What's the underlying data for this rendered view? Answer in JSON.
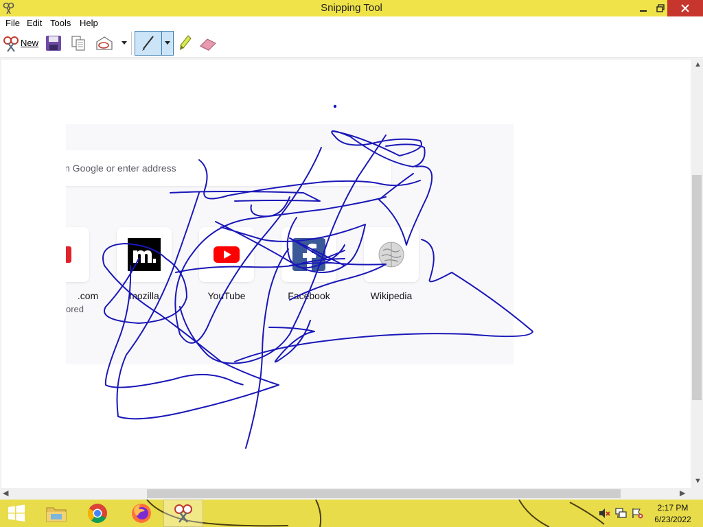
{
  "window": {
    "title": "Snipping Tool"
  },
  "menu": {
    "items": [
      "File",
      "Edit",
      "Tools",
      "Help"
    ]
  },
  "toolbar": {
    "new_label": "New",
    "icons": [
      "snip-scissors-icon",
      "save-icon",
      "copy-icon",
      "send-snip-icon",
      "pen-icon",
      "highlighter-icon",
      "eraser-icon"
    ]
  },
  "captured": {
    "search_placeholder": "n Google or enter address",
    "tiles": [
      {
        "label": ".com",
        "sublabel": "ored",
        "icon": "partial-red-logo-icon"
      },
      {
        "label": "mozilla",
        "icon": "mozilla-logo-icon"
      },
      {
        "label": "YouTube",
        "icon": "youtube-logo-icon"
      },
      {
        "label": "Facebook",
        "icon": "facebook-logo-icon"
      },
      {
        "label": "Wikipedia",
        "icon": "wikipedia-logo-icon"
      }
    ]
  },
  "annotation": {
    "pen_color": "#1a17b8"
  },
  "taskbar": {
    "time": "2:17 PM",
    "date": "6/23/2022",
    "apps": [
      "windows-start-icon",
      "file-explorer-icon",
      "chrome-icon",
      "firefox-icon",
      "snipping-tool-icon"
    ]
  },
  "colors": {
    "titlebar": "#f0e34a",
    "taskbar": "#e8dc4a",
    "close_button": "#c7362c",
    "pen_selected": "#cce4f7"
  }
}
